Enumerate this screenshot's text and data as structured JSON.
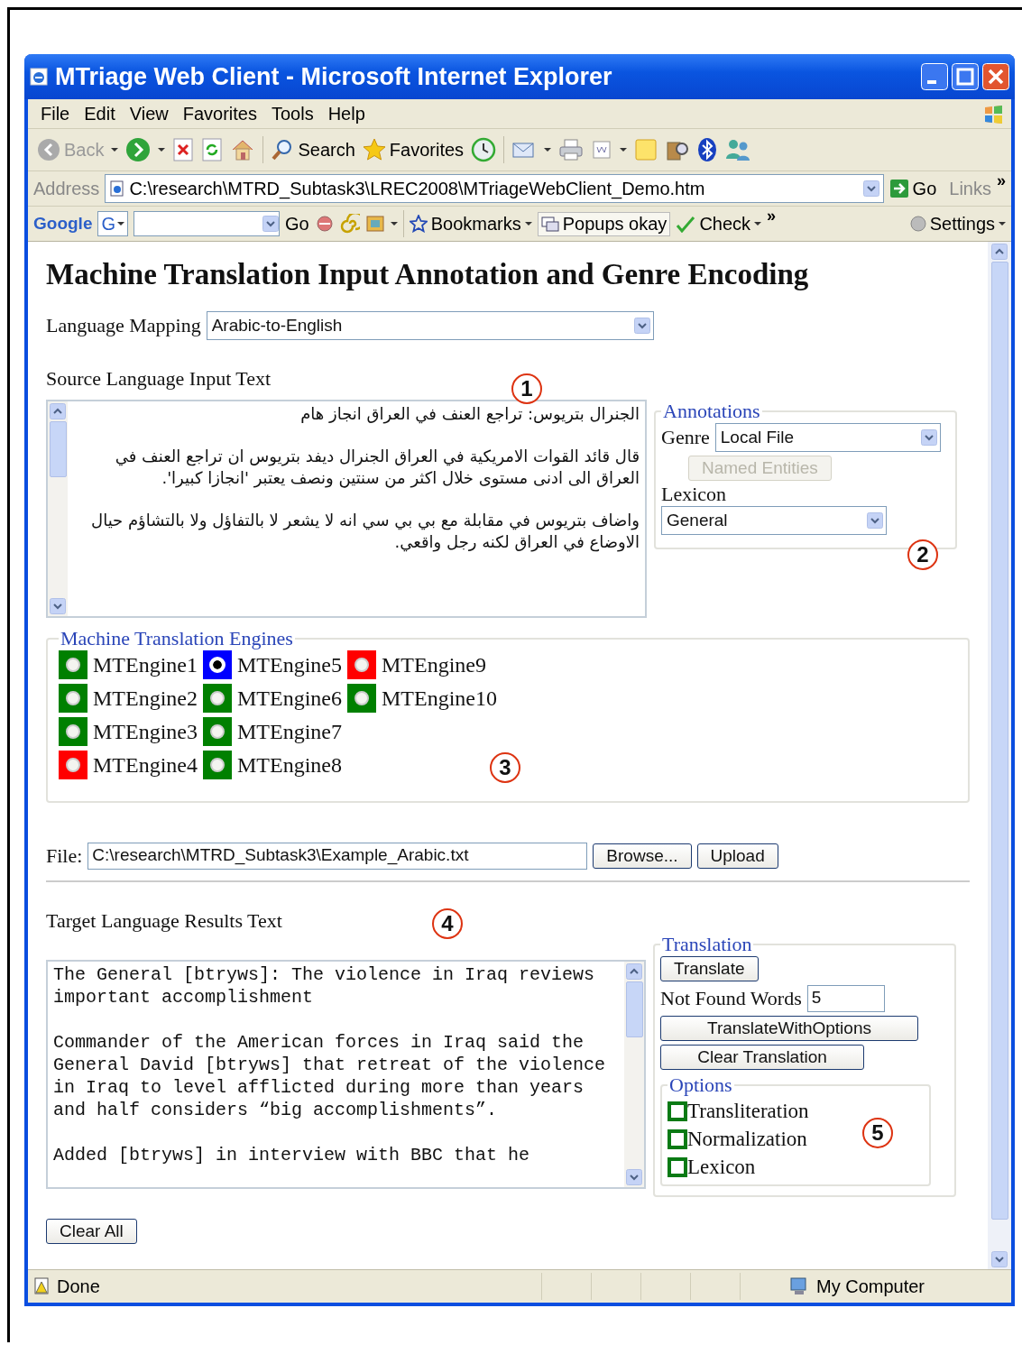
{
  "window": {
    "title": "MTriage Web Client - Microsoft Internet Explorer"
  },
  "menu": [
    "File",
    "Edit",
    "View",
    "Favorites",
    "Tools",
    "Help"
  ],
  "toolbar": {
    "back": "Back",
    "search": "Search",
    "favorites": "Favorites"
  },
  "address_bar": {
    "label": "Address",
    "value": "C:\\research\\MTRD_Subtask3\\LREC2008\\MTriageWebClient_Demo.htm",
    "go": "Go",
    "links": "Links",
    "more": "»"
  },
  "google_bar": {
    "logo": "Google",
    "engine": "G",
    "go": "Go",
    "bookmarks": "Bookmarks",
    "popups": "Popups okay",
    "check": "Check",
    "more": "»",
    "settings": "Settings"
  },
  "page": {
    "heading": "Machine Translation Input Annotation and Genre Encoding",
    "language_mapping": {
      "label": "Language Mapping",
      "value": "Arabic-to-English"
    },
    "source": {
      "label": "Source Language Input Text",
      "paragraphs": [
        "الجنرال بتريوس: تراجع العنف في العراق انجاز هام",
        "قال قائد القوات الامريكية في العراق الجنرال ديفد بتريوس ان تراجع العنف في العراق الى ادنى مستوى خلال اكثر من سنتين ونصف يعتبر 'انجازا كبيرا'.",
        "واضاف بتريوس في مقابلة مع بي بي سي انه لا يشعر لا بالتفاؤل ولا بالتشاؤم حيال الاوضاع في العراق لكنه رجل واقعي."
      ]
    },
    "annotations": {
      "legend": "Annotations",
      "genre_label": "Genre",
      "genre_value": "Local File",
      "named_entities": {
        "label": "Named Entities",
        "disabled": true
      },
      "lexicon_label": "Lexicon",
      "lexicon_value": "General"
    },
    "engines": {
      "legend": "Machine Translation Engines",
      "columns": [
        [
          {
            "label": "MTEngine1",
            "color": "#008000",
            "selected": false
          },
          {
            "label": "MTEngine2",
            "color": "#008000",
            "selected": false
          },
          {
            "label": "MTEngine3",
            "color": "#008000",
            "selected": false
          },
          {
            "label": "MTEngine4",
            "color": "#ff0000",
            "selected": false
          }
        ],
        [
          {
            "label": "MTEngine5",
            "color": "#0000ff",
            "selected": true
          },
          {
            "label": "MTEngine6",
            "color": "#008000",
            "selected": false
          },
          {
            "label": "MTEngine7",
            "color": "#008000",
            "selected": false
          },
          {
            "label": "MTEngine8",
            "color": "#008000",
            "selected": false
          }
        ],
        [
          {
            "label": "MTEngine9",
            "color": "#ff0000",
            "selected": false
          },
          {
            "label": "MTEngine10",
            "color": "#008000",
            "selected": false
          }
        ]
      ]
    },
    "file": {
      "label": "File:",
      "value": "C:\\research\\MTRD_Subtask3\\Example_Arabic.txt",
      "browse": "Browse...",
      "upload": "Upload"
    },
    "target": {
      "label": "Target Language Results Text",
      "paragraphs": [
        "The General [btryws]: The violence in Iraq reviews important accomplishment",
        "Commander of the American forces in Iraq said the General David [btryws] that retreat of the violence in Iraq to level afflicted during more than years and half considers “big accomplishments”.",
        "Added [btryws] in interview with BBC that he"
      ]
    },
    "translation": {
      "legend": "Translation",
      "translate": "Translate",
      "not_found_label": "Not Found Words",
      "not_found_value": "5",
      "translate_with_options": "TranslateWithOptions",
      "clear_translation": "Clear Translation",
      "options": {
        "legend": "Options",
        "items": [
          {
            "label": "Transliteration",
            "checked": false
          },
          {
            "label": "Normalization",
            "checked": false
          },
          {
            "label": "Lexicon",
            "checked": false
          }
        ]
      }
    },
    "clear_all": "Clear All"
  },
  "callouts": [
    "1",
    "2",
    "3",
    "4",
    "5"
  ],
  "status_bar": {
    "text": "Done",
    "zone": "My Computer"
  }
}
